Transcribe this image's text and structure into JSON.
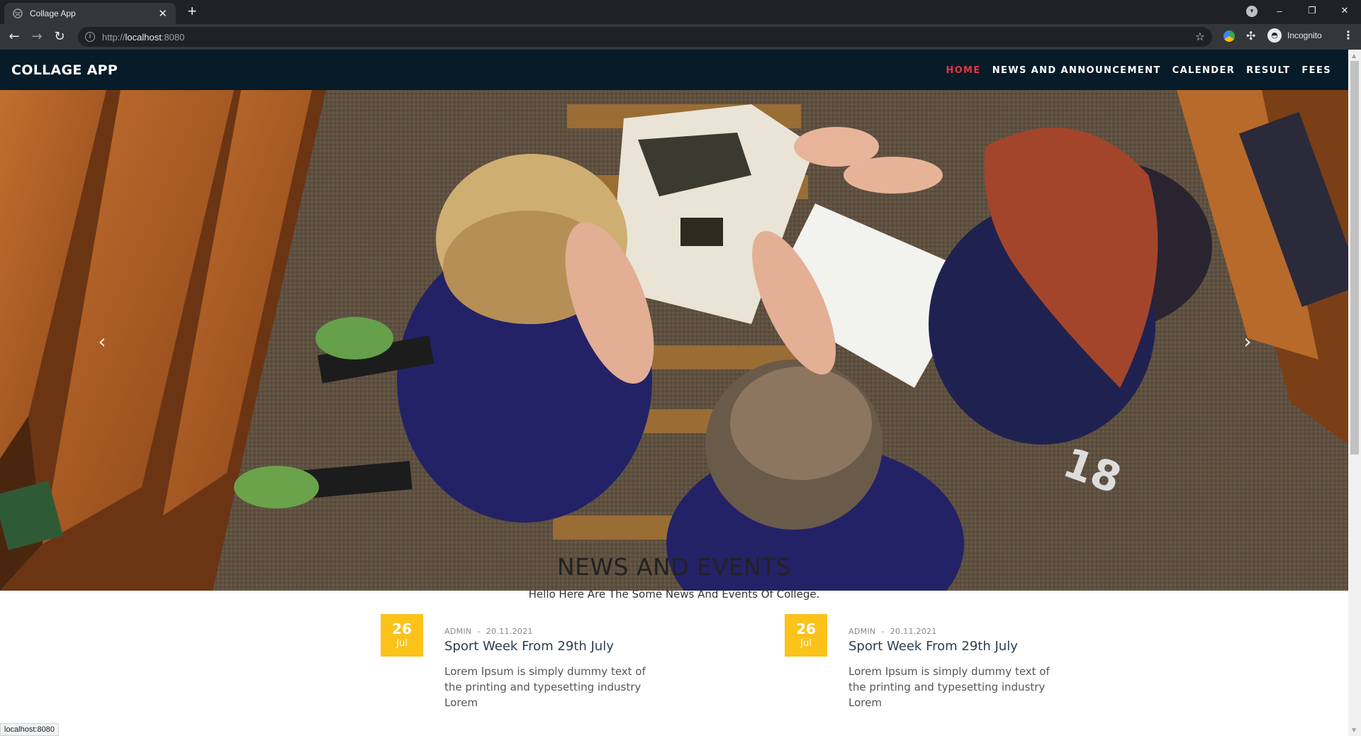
{
  "browser": {
    "tab_title": "Collage App",
    "tab_close": "✕",
    "new_tab": "+",
    "url_scheme": "http://",
    "url_host": "localhost",
    "url_port": ":8080",
    "profile_label": "Incognito",
    "window_controls": [
      "–",
      "❐",
      "✕"
    ],
    "status_url": "localhost:8080"
  },
  "navbar": {
    "brand": "COLLAGE APP",
    "links": [
      "HOME",
      "NEWS AND ANNOUNCEMENT",
      "CALENDER",
      "RESULT",
      "FEES"
    ],
    "active_link": "HOME",
    "accent_color": "#e8343a",
    "background_color": "#071b29"
  },
  "carousel": {
    "prev_icon": "chevron-left-icon",
    "next_icon": "chevron-right-icon",
    "prev_glyph": "‹",
    "next_glyph": "›"
  },
  "news_section": {
    "title": "NEWS AND EVENTS",
    "subtitle": "Hello Here Are The Some News And Events Of College.",
    "date_badge_color": "#fbc21a",
    "items": [
      {
        "day": "26",
        "month": "Jul",
        "author": "ADMIN",
        "separator": "-",
        "date": "20.11.2021",
        "title": "Sport Week From 29th July",
        "text": "Lorem Ipsum is simply dummy text of the printing and typesetting industry Lorem"
      },
      {
        "day": "26",
        "month": "Jul",
        "author": "ADMIN",
        "separator": "-",
        "date": "20.11.2021",
        "title": "Sport Week From 29th July",
        "text": "Lorem Ipsum is simply dummy text of the printing and typesetting industry Lorem"
      }
    ]
  }
}
